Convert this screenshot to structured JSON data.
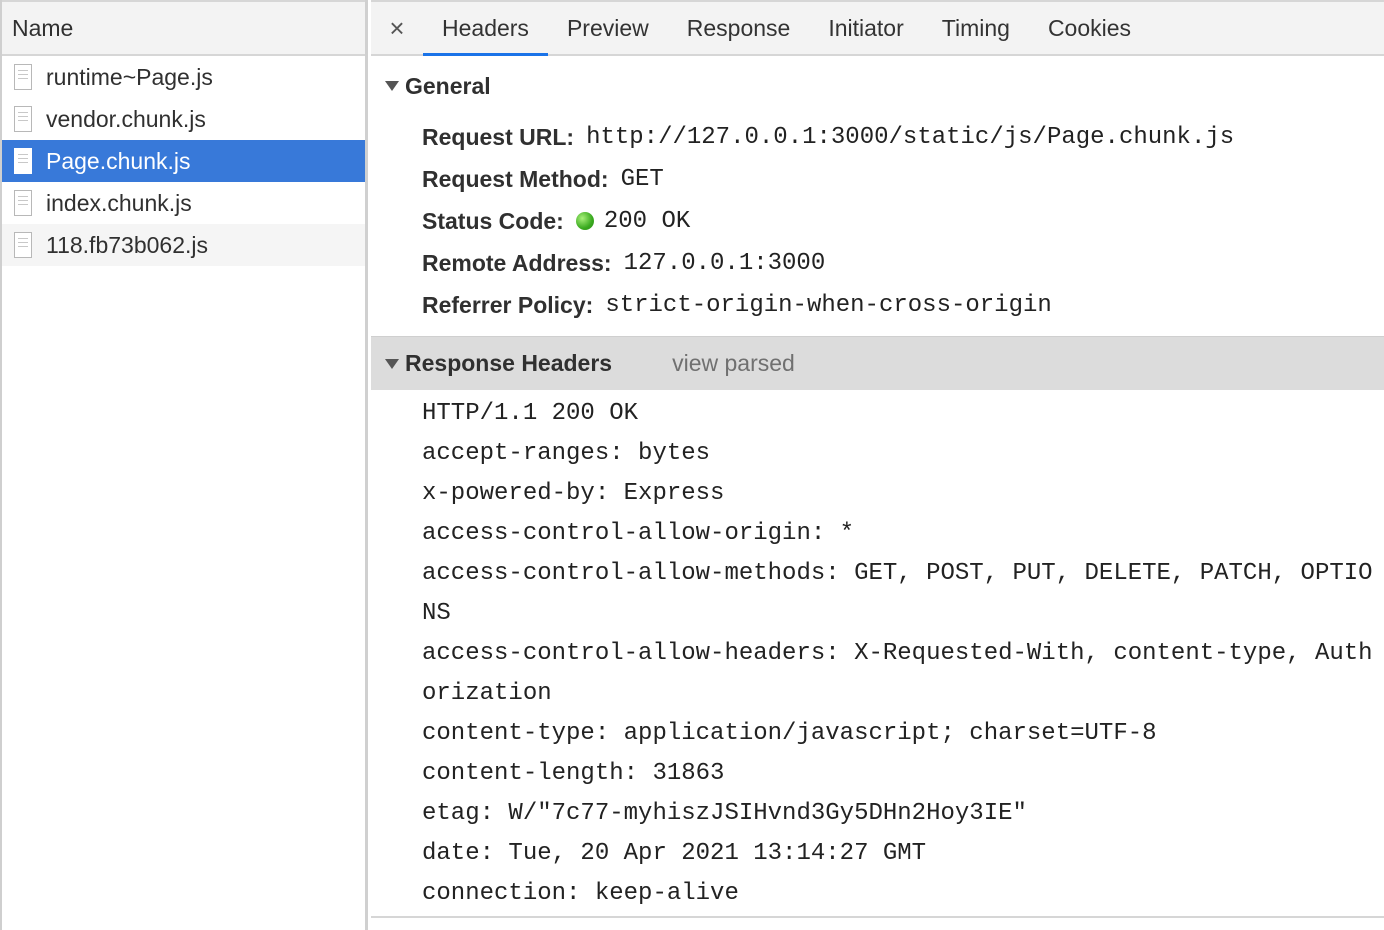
{
  "file_list": {
    "header": "Name",
    "files": [
      {
        "name": "runtime~Page.js"
      },
      {
        "name": "vendor.chunk.js"
      },
      {
        "name": "Page.chunk.js"
      },
      {
        "name": "index.chunk.js"
      },
      {
        "name": "118.fb73b062.js"
      }
    ],
    "selected": "Page.chunk.js"
  },
  "tabs": {
    "close_symbol": "×",
    "items": [
      "Headers",
      "Preview",
      "Response",
      "Initiator",
      "Timing",
      "Cookies"
    ],
    "active": "Headers"
  },
  "general": {
    "title": "General",
    "rows": [
      {
        "key": "Request URL:",
        "value": "http://127.0.0.1:3000/static/js/Page.chunk.js"
      },
      {
        "key": "Request Method:",
        "value": "GET"
      },
      {
        "key": "Status Code:",
        "value": "200 OK"
      },
      {
        "key": "Remote Address:",
        "value": "127.0.0.1:3000"
      },
      {
        "key": "Referrer Policy:",
        "value": "strict-origin-when-cross-origin"
      }
    ],
    "status_color": "#3aaa1f"
  },
  "response_headers": {
    "title": "Response Headers",
    "toggle_link": "view parsed",
    "lines": [
      "HTTP/1.1 200 OK",
      "accept-ranges: bytes",
      "x-powered-by: Express",
      "access-control-allow-origin: *",
      "access-control-allow-methods: GET, POST, PUT, DELETE, PATCH, OPTIO",
      "NS",
      "access-control-allow-headers: X-Requested-With, content-type, Auth",
      "orization",
      "content-type: application/javascript; charset=UTF-8",
      "content-length: 31863",
      "etag: W/\"7c77-myhiszJSIHvnd3Gy5DHn2Hoy3IE\"",
      "date: Tue, 20 Apr 2021 13:14:27 GMT",
      "connection: keep-alive"
    ]
  },
  "colors": {
    "selection": "#3879d9",
    "tab_underline": "#1a73e8"
  }
}
